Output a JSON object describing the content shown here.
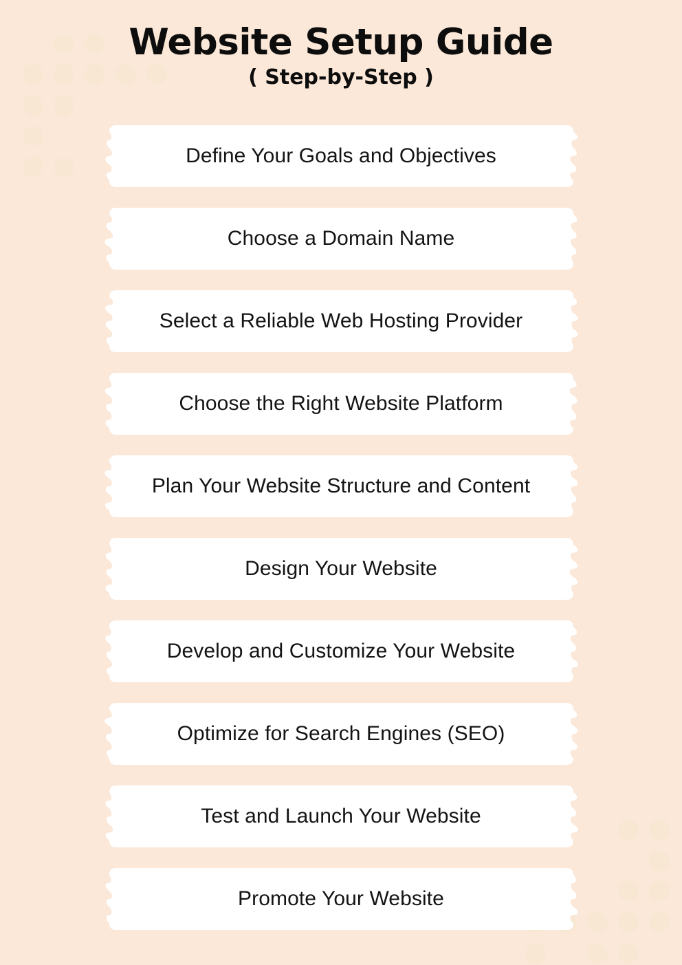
{
  "header": {
    "title": "Website Setup Guide",
    "subtitle": "( Step-by-Step )"
  },
  "colors": {
    "background": "#fbe8d9",
    "card": "#ffffff",
    "text": "#141414",
    "title": "#0d0d0d",
    "dot": "#f7e7d3"
  },
  "steps": [
    {
      "label": "Define Your Goals and Objectives"
    },
    {
      "label": "Choose a Domain Name"
    },
    {
      "label": "Select a Reliable Web Hosting Provider"
    },
    {
      "label": "Choose the Right Website Platform"
    },
    {
      "label": "Plan Your Website Structure and Content"
    },
    {
      "label": "Design Your Website"
    },
    {
      "label": "Develop and Customize Your Website"
    },
    {
      "label": "Optimize for Search Engines (SEO)"
    },
    {
      "label": "Test and Launch Your Website"
    },
    {
      "label": "Promote Your Website"
    }
  ],
  "decoration": {
    "top_left_dots": [
      [
        1,
        0
      ],
      [
        2,
        0
      ],
      [
        4,
        0
      ],
      [
        0,
        1
      ],
      [
        1,
        1
      ],
      [
        2,
        1
      ],
      [
        3,
        1
      ],
      [
        4,
        1
      ],
      [
        0,
        2
      ],
      [
        1,
        2
      ],
      [
        0,
        3
      ],
      [
        0,
        4
      ],
      [
        1,
        4
      ]
    ],
    "bottom_right_dots": [
      [
        3,
        0
      ],
      [
        4,
        0
      ],
      [
        4,
        1
      ],
      [
        3,
        2
      ],
      [
        4,
        2
      ],
      [
        0,
        3
      ],
      [
        1,
        3
      ],
      [
        2,
        3
      ],
      [
        3,
        3
      ],
      [
        4,
        3
      ],
      [
        0,
        4
      ],
      [
        2,
        4
      ],
      [
        3,
        4
      ]
    ]
  }
}
